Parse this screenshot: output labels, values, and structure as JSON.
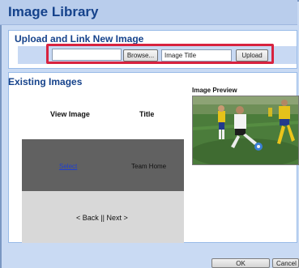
{
  "window": {
    "title": "Image Library"
  },
  "upload": {
    "heading": "Upload and Link New Image",
    "file_value": "",
    "browse_label": "Browse...",
    "title_value": "Image Title",
    "upload_label": "Upload",
    "highlight_color": "#d8233f"
  },
  "existing": {
    "heading": "Existing Images",
    "columns": {
      "view": "View Image",
      "title": "Title"
    },
    "rows": [
      {
        "link": "Select",
        "title": "Team Home"
      }
    ],
    "pager": "< Back || Next >"
  },
  "preview": {
    "label": "Image Preview",
    "image": "soccer-players-photo"
  },
  "footer": {
    "ok_label": "OK",
    "cancel_label": "Cancel"
  },
  "colors": {
    "title_text": "#15428b",
    "selected_row": "#616161",
    "pager_row": "#d8d8d8",
    "link": "#1f3fd0"
  }
}
